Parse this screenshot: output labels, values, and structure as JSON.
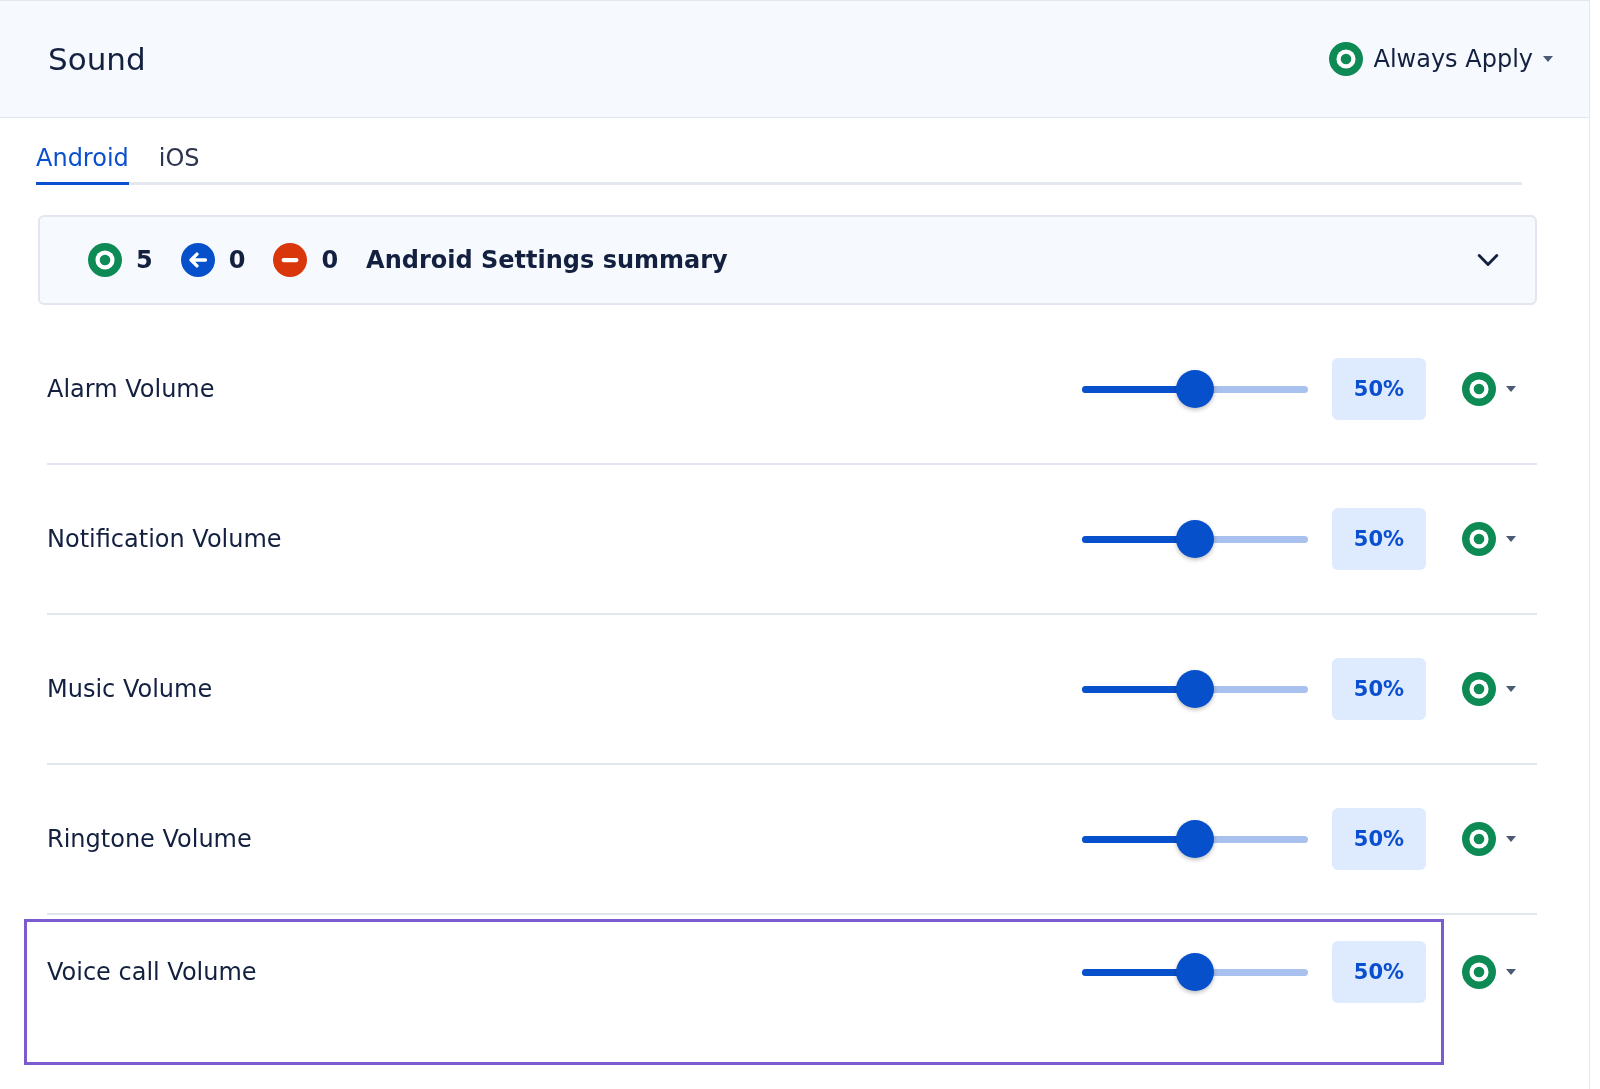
{
  "header": {
    "title": "Sound",
    "policy": {
      "label": "Always Apply",
      "kind": "applied"
    }
  },
  "tabs": [
    {
      "label": "Android",
      "selected": true
    },
    {
      "label": "iOS",
      "selected": false
    }
  ],
  "summary": {
    "counts": [
      {
        "kind": "applied",
        "count": "5"
      },
      {
        "kind": "reverted",
        "count": "0"
      },
      {
        "kind": "blocked",
        "count": "0"
      }
    ],
    "title": "Android Settings summary",
    "expanded": false
  },
  "settings": [
    {
      "name": "Alarm Volume",
      "level": 0.5,
      "reading": "50%",
      "kind": "applied",
      "highlighted": false
    },
    {
      "name": "Notification Volume",
      "level": 0.5,
      "reading": "50%",
      "kind": "applied",
      "highlighted": false
    },
    {
      "name": "Music Volume",
      "level": 0.5,
      "reading": "50%",
      "kind": "applied",
      "highlighted": false
    },
    {
      "name": "Ringtone Volume",
      "level": 0.5,
      "reading": "50%",
      "kind": "applied",
      "highlighted": false
    },
    {
      "name": "Voice call Volume",
      "level": 0.5,
      "reading": "50%",
      "kind": "applied",
      "highlighted": true
    }
  ]
}
